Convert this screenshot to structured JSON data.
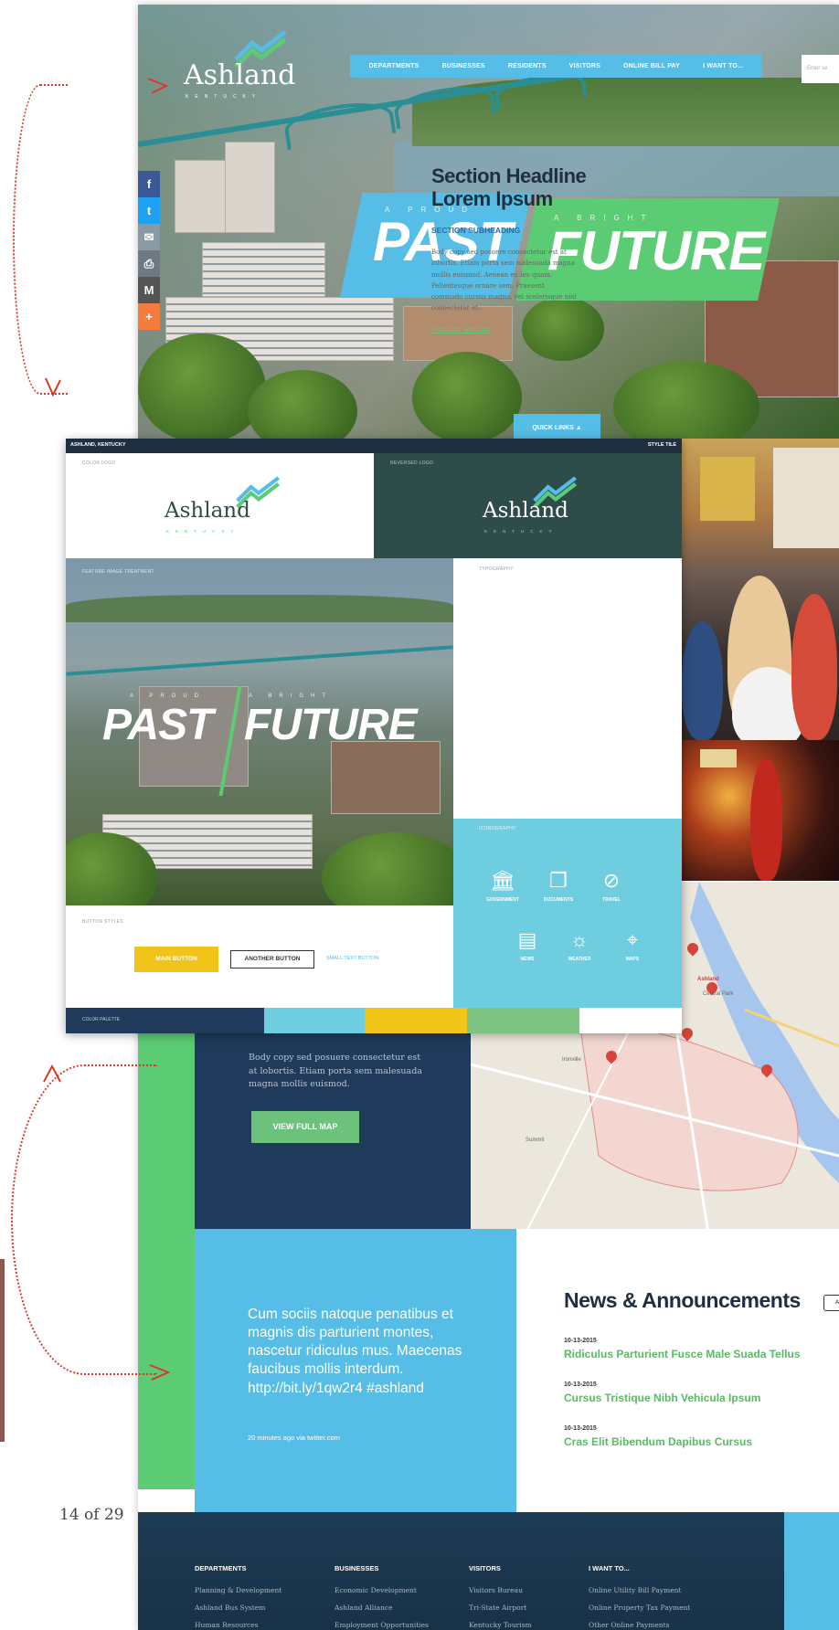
{
  "hero": {
    "logo": "Ashland",
    "logo_sub": "KENTUCKY",
    "nav": [
      "DEPARTMENTS",
      "BUSINESSES",
      "RESIDENTS",
      "VISITORS",
      "ONLINE BILL PAY",
      "I WANT TO..."
    ],
    "search_placeholder": "Enter se",
    "tag_past_small": "A PROUD",
    "tag_past": "PAST",
    "tag_future_small": "A BRIGHT",
    "tag_future": "FUTURE",
    "quick_links": "QUICK LINKS ▲",
    "share_icons": [
      "facebook-icon",
      "twitter-icon",
      "mail-icon",
      "print-icon",
      "gmail-icon",
      "plus-icon"
    ]
  },
  "tile": {
    "top_left": "ASHLAND, KENTUCKY",
    "top_right": "STYLE TILE",
    "color_logo_label": "COLOR LOGO",
    "reversed_logo_label": "REVERSED LOGO",
    "logo_word": "Ashland",
    "logo_sub": "KENTUCKY",
    "feature_label": "FEATURE IMAGE TREATMENT",
    "feature_past_small": "A PROUD",
    "feature_past": "PAST",
    "feature_future_small": "A BRIGHT",
    "feature_future": "FUTURE",
    "typography_label": "TYPOGRAPHY",
    "headline": "Section Headline Lorem Ipsum",
    "subheading": "SECTION SUBHEADING",
    "body": "Body copy sed posuere consectetur est at lobortis. Etiam porta sem malesuada magna mollis euismod. Aenean eu leo quam. Pellentesque ornare sem. Praesent commodo cursus magna, vel scelerisque nisl consectetur et.",
    "link": "Standard text link",
    "iconography_label": "ICONOGRAPHY",
    "icons": [
      {
        "name": "government-icon",
        "glyph": "🏛",
        "label": "GOVERNMENT"
      },
      {
        "name": "documents-icon",
        "glyph": "❐",
        "label": "DOCUMENTS"
      },
      {
        "name": "travel-icon",
        "glyph": "⊘",
        "label": "TRAVEL"
      },
      {
        "name": "news-icon",
        "glyph": "▤",
        "label": "NEWS"
      },
      {
        "name": "weather-icon",
        "glyph": "☼",
        "label": "WEATHER"
      },
      {
        "name": "maps-icon",
        "glyph": "⌖",
        "label": "MAPS"
      }
    ],
    "button_styles_label": "BUTTON STYLES",
    "main_button": "MAIN BUTTON",
    "another_button": "ANOTHER BUTTON",
    "small_text_button": "SMALL TEXT BUTTON",
    "color_palette_label": "COLOR PALETTE",
    "palette": [
      "#1f3a5a",
      "#6fcde0",
      "#f0c419",
      "#7cc47f",
      "#ffffff"
    ]
  },
  "map": {
    "body": "Body copy sed posuere consectetur est at lobortis. Etiam porta sem malesuada magna mollis euismod.",
    "button": "VIEW FULL MAP",
    "labels": [
      "Ashland",
      "Central Park",
      "Ironville",
      "Summit"
    ]
  },
  "tweet": {
    "text": "Cum sociis natoque penatibus et magnis dis parturient montes, nascetur ridiculus mus. Maecenas faucibus mollis interdum. http://bit.ly/1qw2r4  #ashland",
    "meta_prefix": "20 minutes ago via ",
    "meta_link": "twitter.com"
  },
  "news": {
    "title": "News & Announcements",
    "more": "A",
    "items": [
      {
        "date": "10-13-2015",
        "headline": "Ridiculus Parturient Fusce Male Suada Tellus"
      },
      {
        "date": "10-13-2015",
        "headline": "Cursus Tristique Nibh Vehicula Ipsum"
      },
      {
        "date": "10-13-2015",
        "headline": "Cras Elit Bibendum Dapibus Cursus"
      }
    ]
  },
  "footer": {
    "columns": [
      {
        "head": "DEPARTMENTS",
        "links": [
          "Planning & Development",
          "Ashland Bus System",
          "Human Resources"
        ]
      },
      {
        "head": "BUSINESSES",
        "links": [
          "Economic Development",
          "Ashland Alliance",
          "Employment Opportunities"
        ]
      },
      {
        "head": "VISITORS",
        "links": [
          "Visitors Bureau",
          "Tri-State Airport",
          "Kentucky Tourism"
        ]
      },
      {
        "head": "I WANT TO...",
        "links": [
          "Online Utility Bill Payment",
          "Online Property Tax Payment",
          "Other Online Payments"
        ]
      }
    ]
  },
  "page_count": "14 of 29",
  "colors": {
    "blue": "#55bde6",
    "green": "#5bcb74",
    "navy": "#1f3a5a",
    "yellow": "#f0c419",
    "red_arrow": "#d9382b"
  }
}
